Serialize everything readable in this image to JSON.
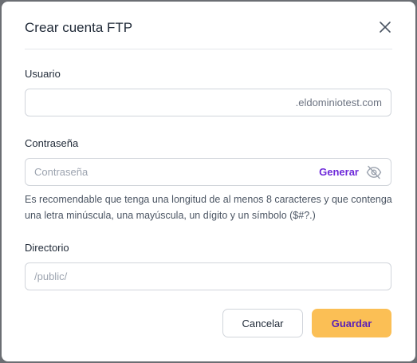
{
  "dialog": {
    "title": "Crear cuenta FTP",
    "close_icon": "close-icon"
  },
  "user": {
    "label": "Usuario",
    "value": "",
    "suffix": ".eldominiotest.com"
  },
  "password": {
    "label": "Contraseña",
    "placeholder": "Contraseña",
    "value": "",
    "generate_label": "Generar",
    "toggle_icon": "eye-off-icon",
    "help": "Es recomendable que tenga una longitud de al menos 8 caracteres y que contenga una letra minúscula, una mayúscula, un dígito y un símbolo ($#?.)"
  },
  "directory": {
    "label": "Directorio",
    "placeholder": "/public/",
    "value": ""
  },
  "actions": {
    "cancel_label": "Cancelar",
    "save_label": "Guardar"
  },
  "colors": {
    "accent": "#6d28d9",
    "save_bg": "#fbbf55"
  }
}
